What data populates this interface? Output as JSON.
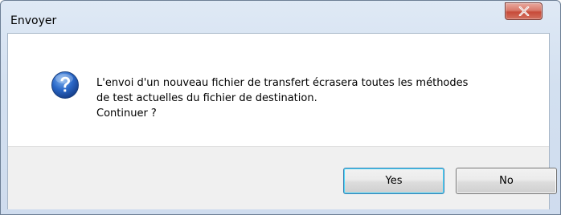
{
  "window": {
    "title": "Envoyer"
  },
  "icons": {
    "close": "close-icon",
    "question": "question-icon"
  },
  "message": {
    "line1": "L'envoi d'un nouveau fichier de transfert écrasera toutes les méthodes",
    "line2": "de test actuelles du fichier de destination.",
    "line3": "Continuer ?"
  },
  "buttons": {
    "yes_label": "Yes",
    "no_label": "No"
  },
  "colors": {
    "close_button": "#c74b3a",
    "question_icon": "#1f5db5",
    "footer_background": "#f0f0f0"
  }
}
